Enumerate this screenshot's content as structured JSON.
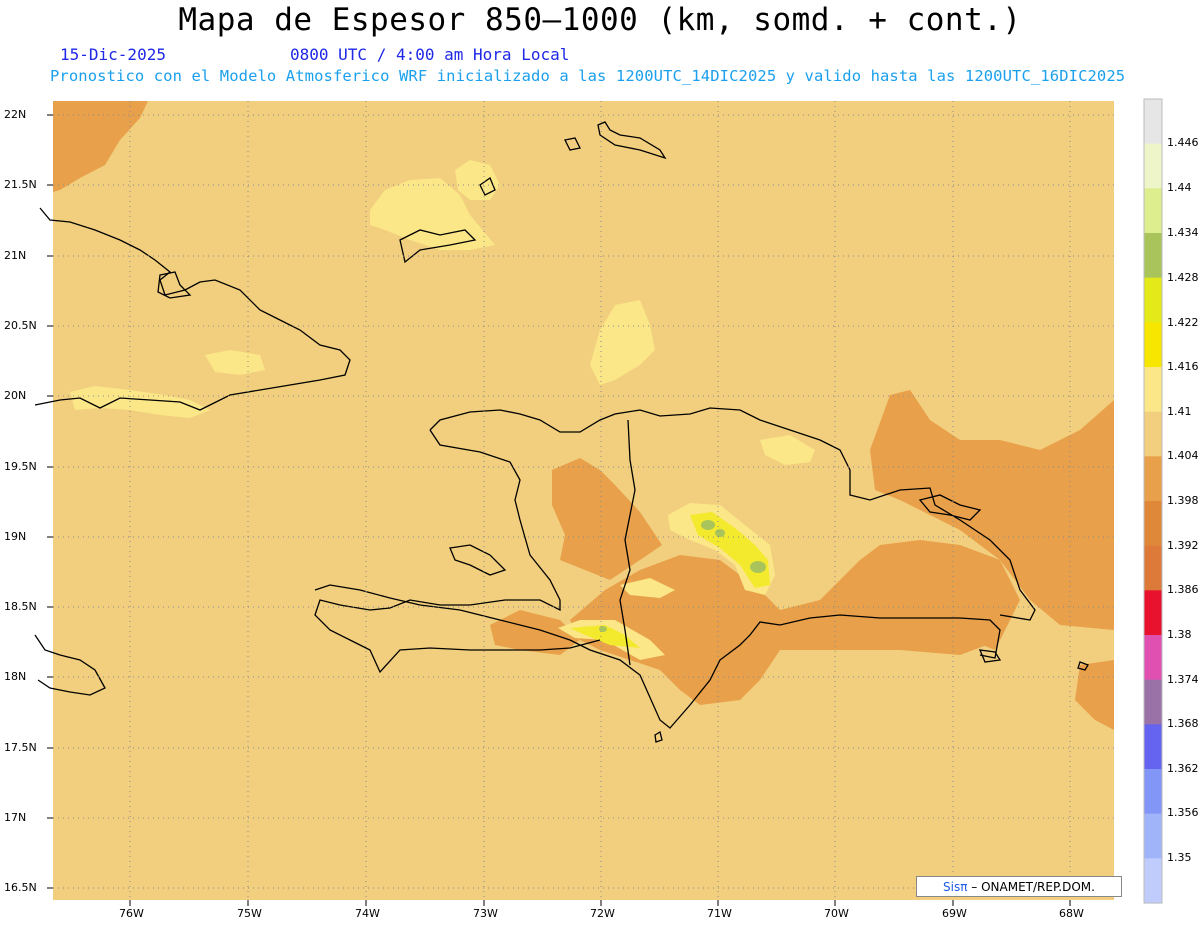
{
  "title": "Mapa de Espesor 850—1000 (km, somd. + cont.)",
  "date": "15-Dic-2025",
  "time": "0800 UTC / 4:00 am Hora Local",
  "description": "Pronostico con el Modelo Atmosferico WRF inicializado a las 1200UTC_14DIC2025 y valido hasta las  1200UTC_16DIC2025",
  "map": {
    "lat_labels": [
      "22N",
      "21.5N",
      "21N",
      "20.5N",
      "20N",
      "19.5N",
      "19N",
      "18.5N",
      "18N",
      "17.5N",
      "17N",
      "16.5N"
    ],
    "lon_labels": [
      "76W",
      "75W",
      "74W",
      "73W",
      "72W",
      "71W",
      "70W",
      "69W",
      "68W"
    ],
    "colors": {
      "background": "#f2cf7e",
      "low": "#e8a04a",
      "high_1": "#fbe688",
      "high_2": "#f3ea2e",
      "high_3": "#a9c45a"
    }
  },
  "colorbar": {
    "levels": [
      "1.446",
      "1.44",
      "1.434",
      "1.428",
      "1.422",
      "1.416",
      "1.41",
      "1.404",
      "1.398",
      "1.392",
      "1.386",
      "1.38",
      "1.374",
      "1.368",
      "1.362",
      "1.356",
      "1.35"
    ],
    "colors": [
      "#e6e6e6",
      "#eef5c8",
      "#dcee8e",
      "#a9c45a",
      "#e4ea1a",
      "#f7e600",
      "#fbe688",
      "#f2cf7e",
      "#e8a04a",
      "#e0883a",
      "#dd7a3a",
      "#e8122e",
      "#e050b0",
      "#9a72a8",
      "#6464f0",
      "#8296f8",
      "#a0b4fa",
      "#c0ccfc"
    ]
  },
  "credit": {
    "logo": "Sisπ",
    "text": "– ONAMET/REP.DOM."
  }
}
